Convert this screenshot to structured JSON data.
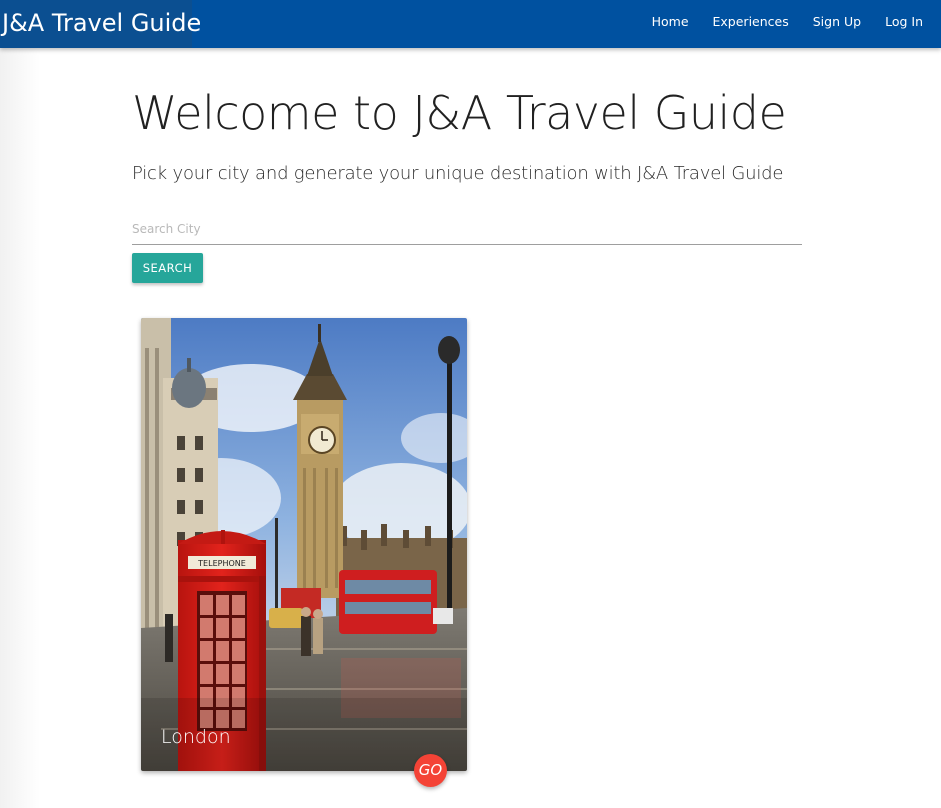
{
  "nav": {
    "brand": "J&A Travel Guide",
    "links": [
      "Home",
      "Experiences",
      "Sign Up",
      "Log In"
    ]
  },
  "hero": {
    "title": "Welcome to J&A Travel Guide",
    "subtitle": "Pick your city and generate your unique destination with J&A Travel Guide"
  },
  "search": {
    "placeholder": "Search City",
    "value": "",
    "button_label": "SEARCH"
  },
  "cards": [
    {
      "title": "London",
      "action_label": "GO",
      "image_sign_text": "TELEPHONE"
    }
  ],
  "colors": {
    "navbar": "#0051a0",
    "brand_bg": "#0b4f91",
    "search_button": "#26a69a",
    "go_button": "#f44336"
  }
}
